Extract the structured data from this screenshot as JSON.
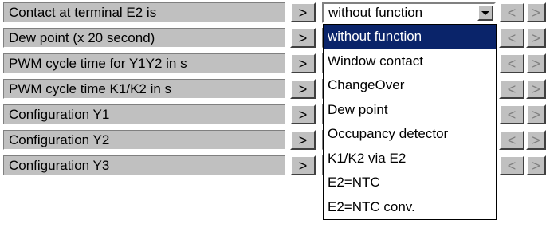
{
  "rows": [
    {
      "label": "Contact at terminal E2 is",
      "value": "without function"
    },
    {
      "label": "Dew point (x 20 second)",
      "value": ""
    },
    {
      "label_prefix": "PWM cycle time for Y1",
      "label_u": "Y",
      "label_suffix": "2 in s",
      "value": ""
    },
    {
      "label": "PWM cycle time K1/K2 in s",
      "value": ""
    },
    {
      "label": "Configuration Y1",
      "value": ""
    },
    {
      "label": "Configuration Y2",
      "value": ""
    },
    {
      "label": "Configuration Y3",
      "value": ""
    }
  ],
  "buttons": {
    "go": ">",
    "prev": "<",
    "next": ">"
  },
  "dropdown": {
    "selected_index": 0,
    "options": [
      "without function",
      "Window contact",
      "ChangeOver",
      "Dew point",
      "Occupancy detector",
      "K1/K2 via E2",
      "E2=NTC",
      "E2=NTC conv."
    ]
  },
  "colors": {
    "panel": "#c0c0c0",
    "selection": "#0a246a",
    "disabled_text": "#808080"
  }
}
